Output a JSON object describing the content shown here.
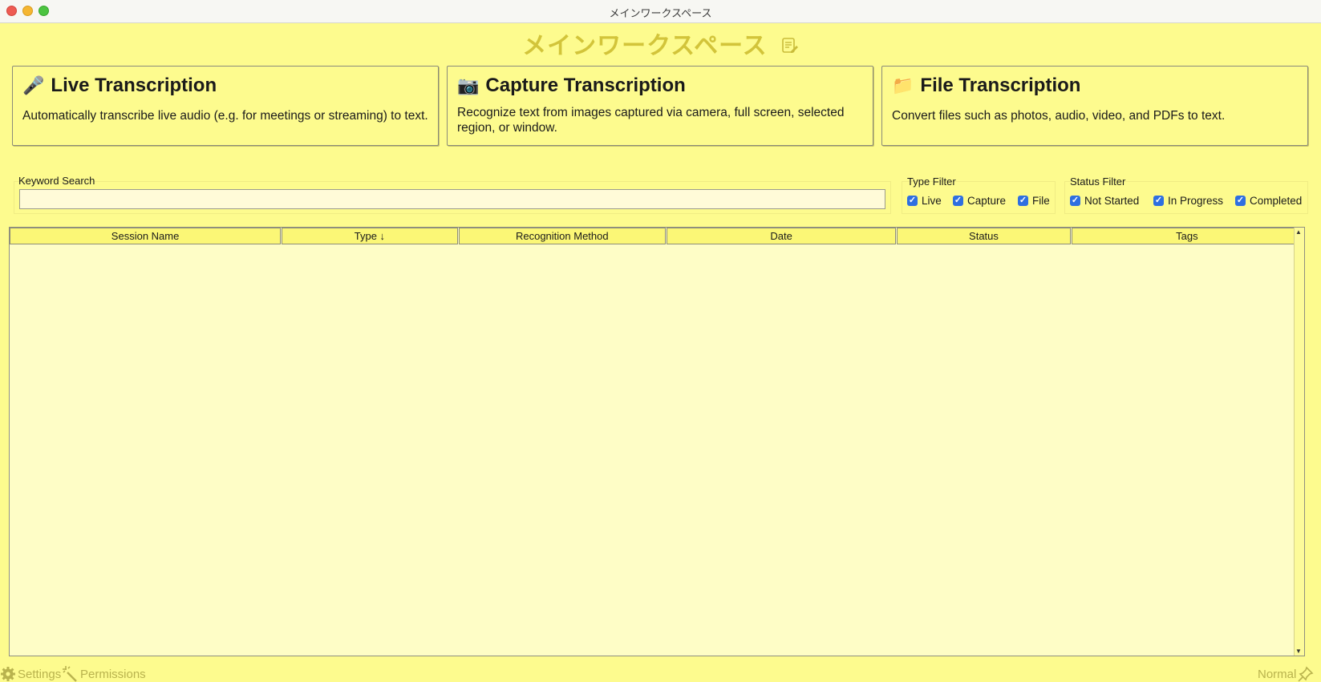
{
  "window": {
    "title": "メインワークスペース"
  },
  "header": {
    "title": "メインワークスペース",
    "icon": "note-edit-icon"
  },
  "cards": [
    {
      "icon": "🎤",
      "title": "Live Transcription",
      "description": "Automatically transcribe live audio (e.g. for meetings or streaming) to text."
    },
    {
      "icon": "📷",
      "title": "Capture Transcription",
      "description": "Recognize text from images captured via camera, full screen, selected region, or window."
    },
    {
      "icon": "📁",
      "title": "File Transcription",
      "description": "Convert files such as photos, audio, video, and PDFs to text."
    }
  ],
  "search": {
    "label": "Keyword Search",
    "value": "",
    "placeholder": ""
  },
  "type_filter": {
    "label": "Type Filter",
    "options": [
      {
        "label": "Live",
        "checked": true
      },
      {
        "label": "Capture",
        "checked": true
      },
      {
        "label": "File",
        "checked": true
      }
    ]
  },
  "status_filter": {
    "label": "Status Filter",
    "options": [
      {
        "label": "Not Started",
        "checked": true
      },
      {
        "label": "In Progress",
        "checked": true
      },
      {
        "label": "Completed",
        "checked": true
      }
    ]
  },
  "table": {
    "columns": [
      "Session Name",
      "Type ↓",
      "Recognition Method",
      "Date",
      "Status",
      "Tags"
    ],
    "rows": []
  },
  "footer": {
    "settings_label": "Settings",
    "permissions_label": "Permissions",
    "mode_label": "Normal"
  },
  "colors": {
    "background": "#fdfb8e",
    "accent_title": "#d2c43a",
    "checkbox": "#2f6fe0"
  }
}
